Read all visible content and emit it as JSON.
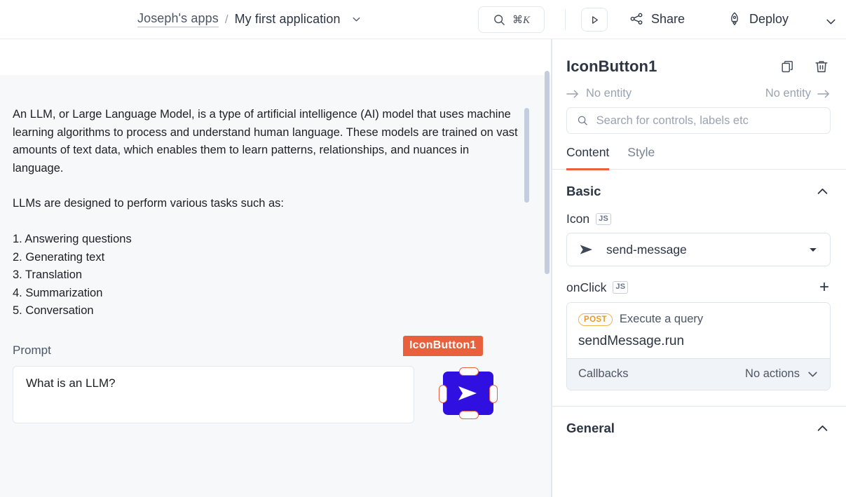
{
  "topbar": {
    "org_name": "Joseph's apps",
    "separator": "/",
    "app_name": "My first application",
    "app_caret_icon": "chevron-down-icon",
    "search": {
      "icon": "search-icon",
      "shortcut_modifier": "⌘",
      "shortcut_key": "K"
    },
    "play_label": "run-preview",
    "share_label": "Share",
    "deploy_label": "Deploy",
    "share_icon": "share-nodes-icon",
    "deploy_icon": "rocket-icon",
    "overflow_icon": "chevron-down-icon"
  },
  "canvas": {
    "response_text": {
      "paragraph1": "An LLM, or Large Language Model, is a type of artificial intelligence (AI) model that uses machine learning algorithms to process and understand human language. These models are trained on vast amounts of text data, which enables them to learn patterns, relationships, and nuances in language.",
      "paragraph2": "LLMs are designed to perform various tasks such as:",
      "list": [
        "1. Answering questions",
        "2. Generating text",
        "3. Translation",
        "4. Summarization",
        "5. Conversation"
      ]
    },
    "prompt": {
      "label": "Prompt",
      "value": "What is an LLM?",
      "placeholder": "What is an LLM?"
    },
    "selected_widget": {
      "name": "IconButton1",
      "icon": "send-message-icon",
      "badge_color": "#e8603c",
      "button_color": "#3010e0"
    }
  },
  "panel": {
    "title": "IconButton1",
    "copy_icon": "copy-icon",
    "delete_icon": "trash-icon",
    "entity_prev": {
      "label": "No entity",
      "icon": "arrow-right-icon"
    },
    "entity_next": {
      "label": "No entity",
      "icon": "arrow-right-icon"
    },
    "search": {
      "icon": "search-icon",
      "value": "",
      "placeholder": "Search for controls, labels etc"
    },
    "tabs": [
      {
        "label": "Content",
        "active": true
      },
      {
        "label": "Style",
        "active": false
      }
    ],
    "active_tab_color": "#e8603c",
    "sections": [
      {
        "title": "Basic",
        "collapse_icon": "chevron-up-icon"
      },
      {
        "title": "General",
        "collapse_icon": "chevron-up-icon"
      }
    ],
    "icon_field": {
      "label": "Icon",
      "js_badge": "JS",
      "value": "send-message",
      "value_icon": "send-message-icon",
      "caret_icon": "caret-down-icon"
    },
    "onclick_field": {
      "label": "onClick",
      "js_badge": "JS",
      "add_icon": "plus-icon",
      "action": {
        "method_badge": "POST",
        "description": "Execute a query",
        "query_name": "sendMessage.run",
        "callbacks_label": "Callbacks",
        "callbacks_value": "No actions",
        "callbacks_caret_icon": "chevron-down-icon"
      }
    }
  }
}
